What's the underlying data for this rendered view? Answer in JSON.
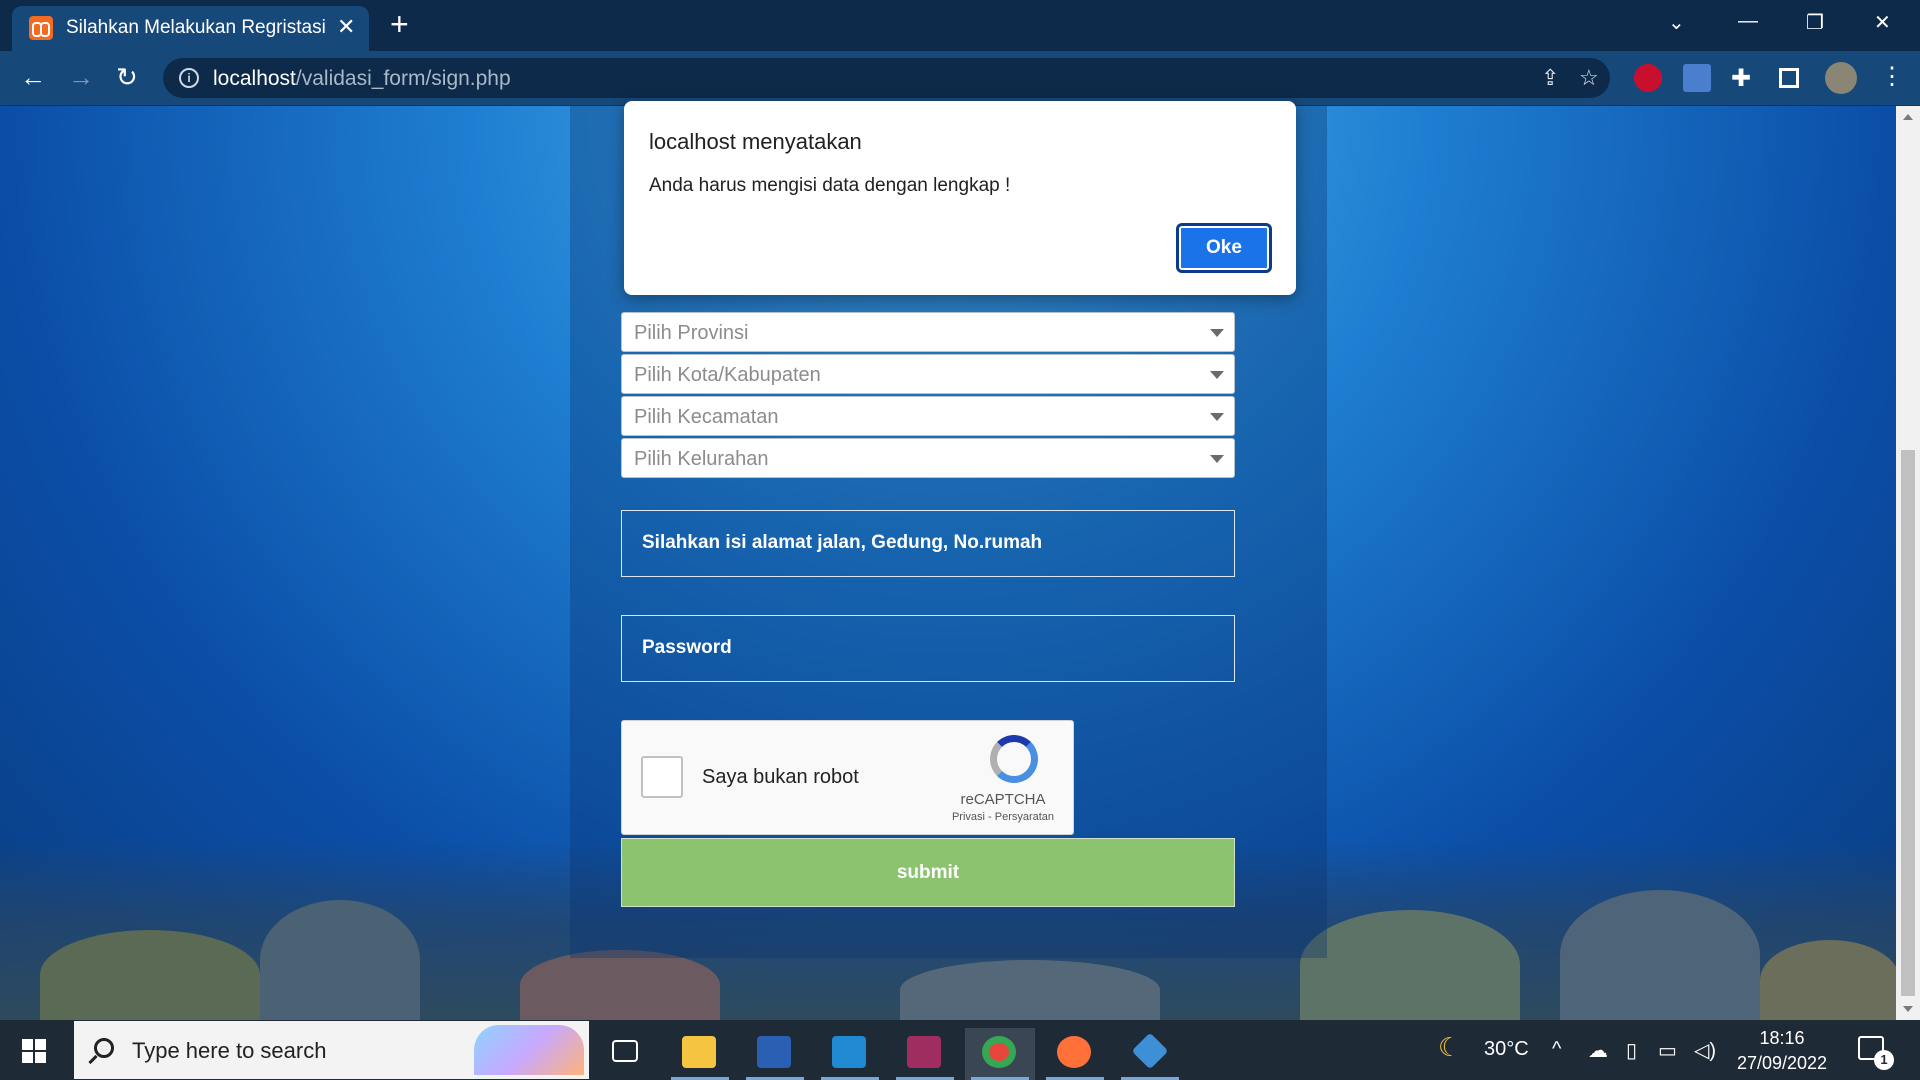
{
  "browser": {
    "tab_title": "Silahkan Melakukan Regristasi",
    "url_host": "localhost",
    "url_path": "/validasi_form/sign.php"
  },
  "form": {
    "selects": [
      {
        "placeholder": "Pilih Provinsi"
      },
      {
        "placeholder": "Pilih Kota/Kabupaten"
      },
      {
        "placeholder": "Pilih Kecamatan"
      },
      {
        "placeholder": "Pilih Kelurahan"
      }
    ],
    "address_placeholder": "Silahkan isi alamat jalan, Gedung, No.rumah",
    "password_placeholder": "Password",
    "captcha": {
      "label": "Saya bukan robot",
      "brand": "reCAPTCHA",
      "terms": "Privasi - Persyaratan"
    },
    "submit_label": "submit"
  },
  "dialog": {
    "title": "localhost menyatakan",
    "message": "Anda harus mengisi data dengan lengkap !",
    "ok_label": "Oke"
  },
  "taskbar": {
    "search_placeholder": "Type here to search",
    "weather": "30°C",
    "time": "18:16",
    "date": "27/09/2022",
    "notification_count": "1"
  },
  "colors": {
    "submit": "#8cc36e",
    "dialog_button": "#1a73e8",
    "chrome_toolbar": "#17487a"
  }
}
